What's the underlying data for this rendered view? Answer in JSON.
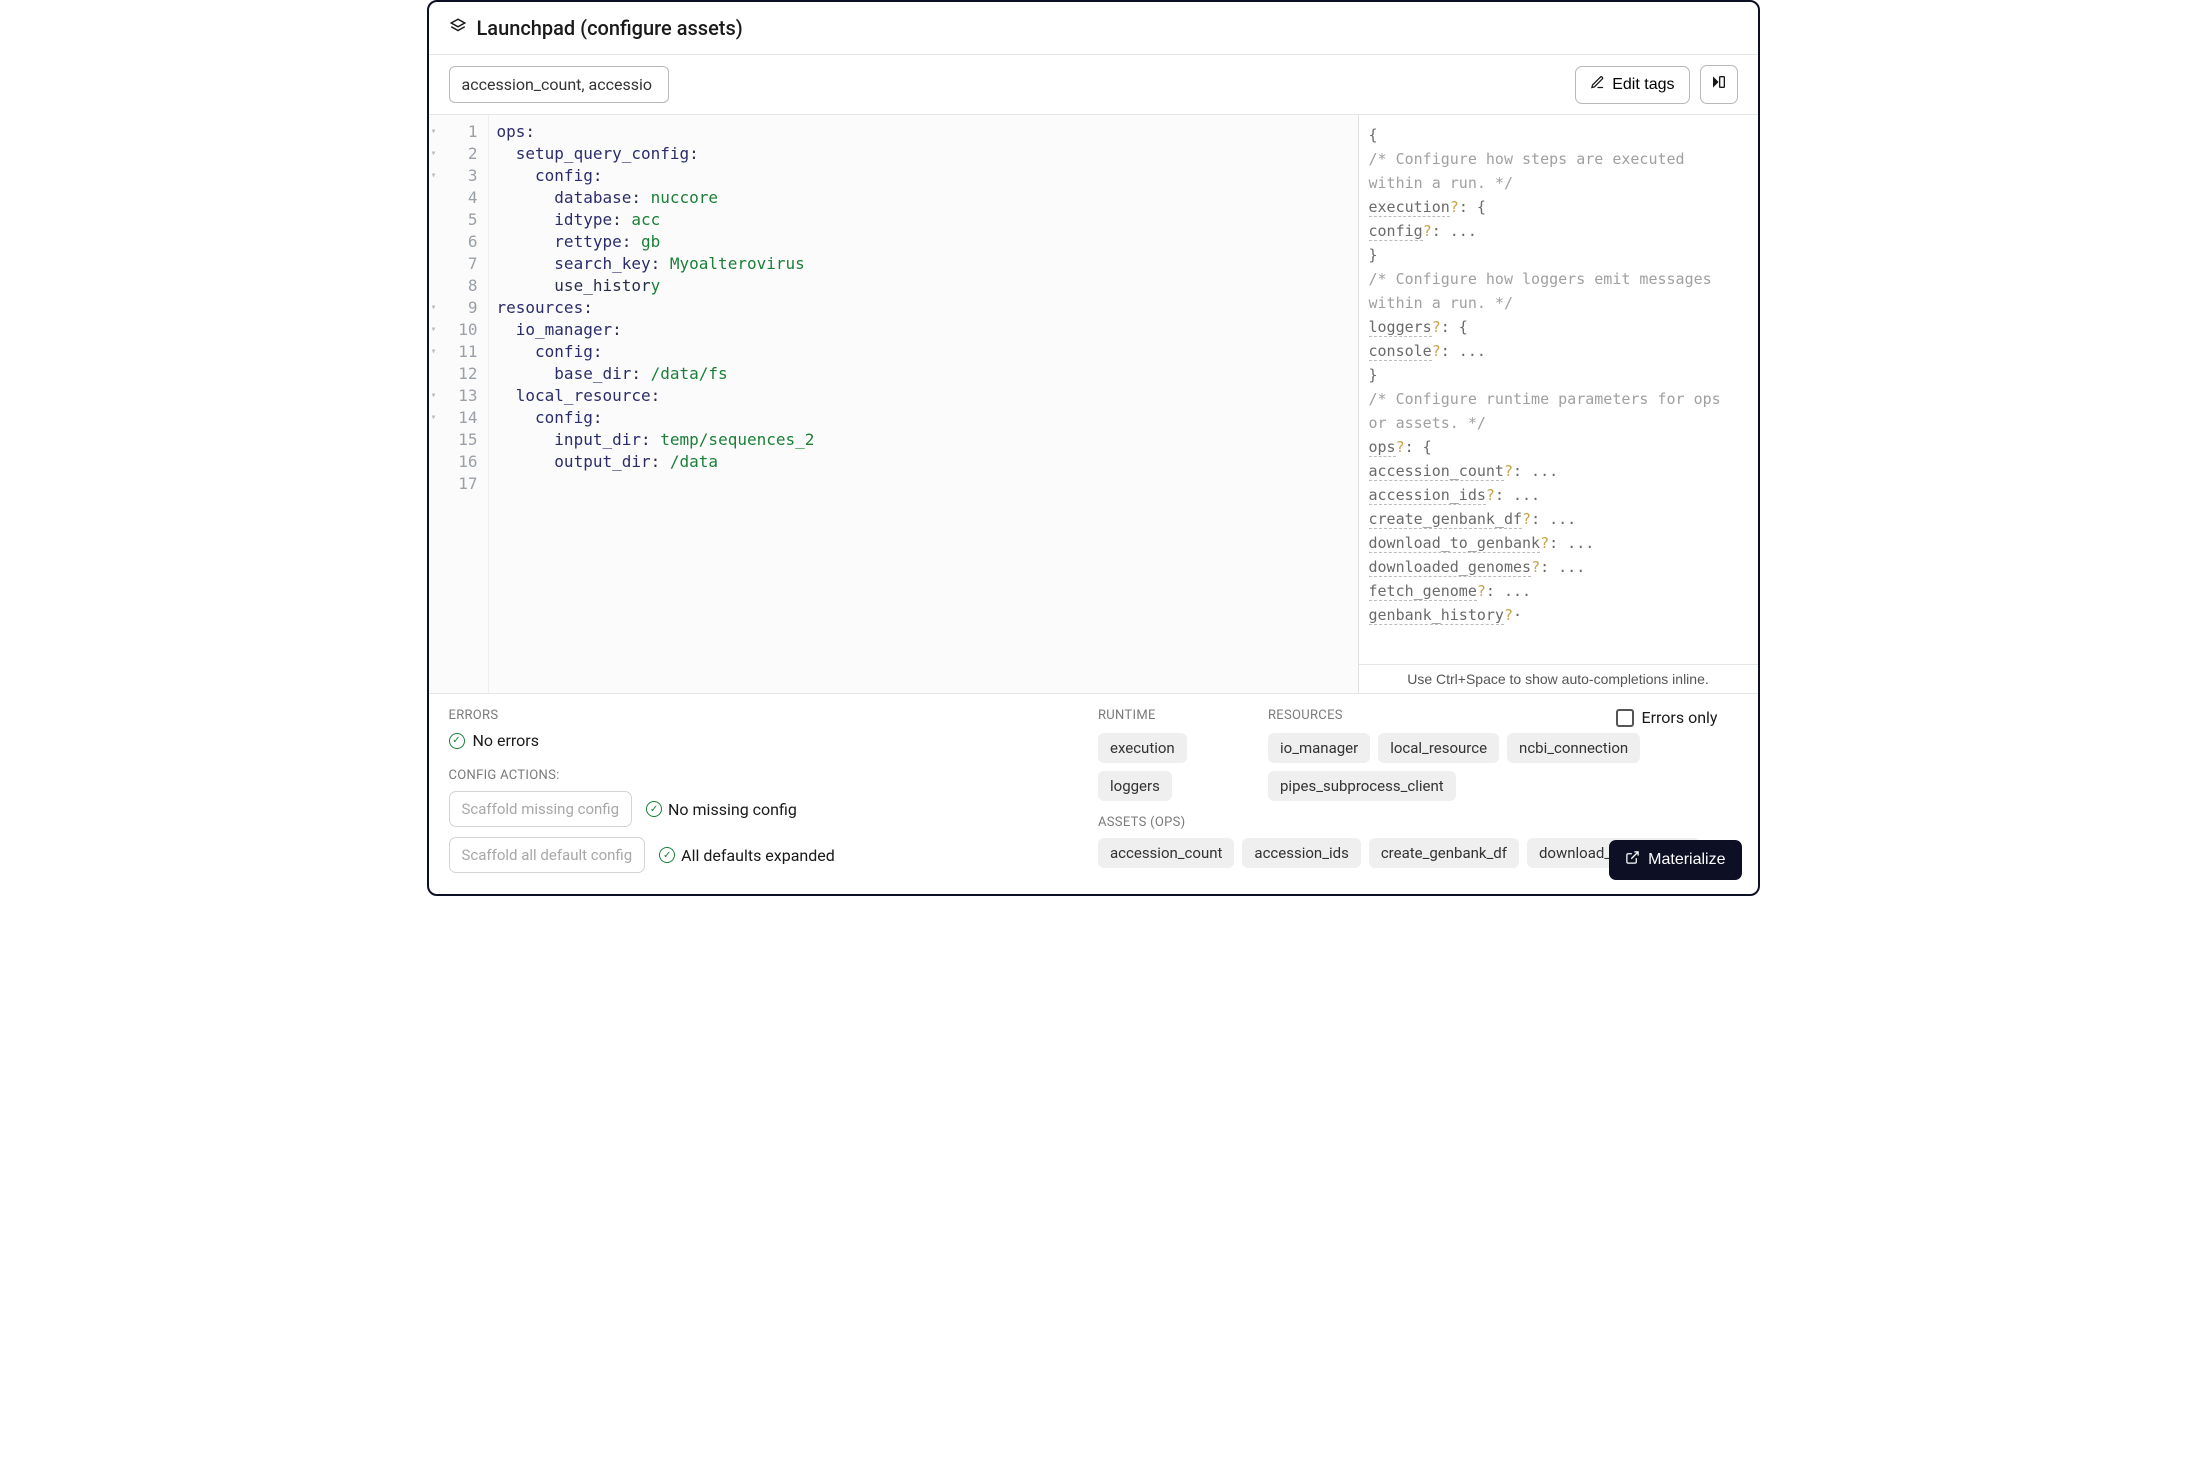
{
  "header": {
    "title": "Launchpad (configure assets)"
  },
  "toolbar": {
    "tag_input_value": "accession_count, accessio",
    "edit_tags_label": "Edit tags"
  },
  "editor": {
    "line_count": 17,
    "fold_lines": [
      1,
      2,
      3,
      9,
      10,
      11,
      13,
      14
    ],
    "lines": [
      {
        "t": "ops:",
        "kw": "ops"
      },
      {
        "t": "  setup_query_config:",
        "kw": "setup_query_config"
      },
      {
        "t": "    config:",
        "kw": "config"
      },
      {
        "t": "      database: nuccore",
        "kw": "database",
        "val": "nuccore"
      },
      {
        "t": "      idtype: acc",
        "kw": "idtype",
        "val": "acc"
      },
      {
        "t": "      rettype: gb",
        "kw": "rettype",
        "val": "gb"
      },
      {
        "t": "      search_key: Myoalterovirus",
        "kw": "search_key",
        "val": "Myoalterovirus"
      },
      {
        "t": "      use_history: y",
        "kw": "use_history",
        "val": "y"
      },
      {
        "t": "resources:",
        "kw": "resources"
      },
      {
        "t": "  io_manager:",
        "kw": "io_manager"
      },
      {
        "t": "    config:",
        "kw": "config"
      },
      {
        "t": "      base_dir: /data/fs",
        "kw": "base_dir",
        "val": "/data/fs"
      },
      {
        "t": "  local_resource:",
        "kw": "local_resource"
      },
      {
        "t": "    config:",
        "kw": "config"
      },
      {
        "t": "      input_dir: temp/sequences_2",
        "kw": "input_dir",
        "val": "temp/sequences_2"
      },
      {
        "t": "      output_dir: /data",
        "kw": "output_dir",
        "val": "/data"
      },
      {
        "t": ""
      }
    ]
  },
  "hint": {
    "open_brace": "{",
    "comment1": "  /* Configure how steps are executed\n     within a run. */",
    "execution_key": "execution",
    "config_key": "config",
    "comment2": "  /* Configure how loggers emit messages\n     within a run. */",
    "loggers_key": "loggers",
    "console_key": "console",
    "comment3": "  /* Configure runtime parameters for ops\n     or assets. */",
    "ops_key": "ops",
    "ops_children": [
      "accession_count",
      "accession_ids",
      "create_genbank_df",
      "download_to_genbank",
      "downloaded_genomes",
      "fetch_genome",
      "genbank_history"
    ],
    "footer": "Use Ctrl+Space to show auto-completions inline."
  },
  "bottom": {
    "errors_label": "ERRORS",
    "no_errors_text": "No errors",
    "config_actions_label": "CONFIG ACTIONS:",
    "scaffold_missing_label": "Scaffold missing config",
    "no_missing_text": "No missing config",
    "scaffold_default_label": "Scaffold all default config",
    "all_defaults_text": "All defaults expanded",
    "runtime_label": "RUNTIME",
    "runtime_chips": [
      "execution",
      "loggers"
    ],
    "resources_label": "RESOURCES",
    "resources_chips": [
      "io_manager",
      "local_resource",
      "ncbi_connection",
      "pipes_subprocess_client"
    ],
    "assets_label": "ASSETS (OPS)",
    "assets_chips": [
      "accession_count",
      "accession_ids",
      "create_genbank_df",
      "download_to_genbank"
    ],
    "errors_only_label": "Errors only"
  },
  "footer": {
    "materialize_label": "Materialize"
  }
}
